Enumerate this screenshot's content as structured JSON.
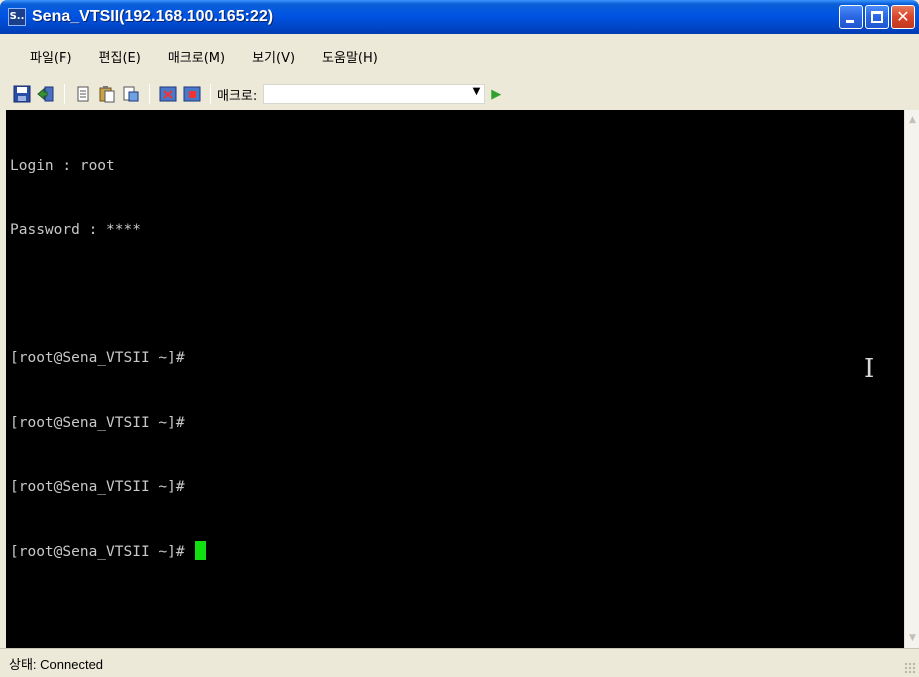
{
  "window": {
    "app_icon_text": "S..",
    "title": "Sena_VTSII(192.168.100.165:22)",
    "controls": {
      "minimize": "minimize",
      "maximize": "maximize",
      "close": "close"
    }
  },
  "menu": {
    "items": [
      {
        "label": "파일(F)"
      },
      {
        "label": "편집(E)"
      },
      {
        "label": "매크로(M)"
      },
      {
        "label": "보기(V)"
      },
      {
        "label": "도움말(H)"
      }
    ]
  },
  "toolbar": {
    "icons": [
      "save-icon",
      "connect-icon",
      "copy-icon",
      "paste-icon",
      "paste-special-icon",
      "macro-record-icon",
      "macro-stop-icon"
    ],
    "macro_label": "매크로:",
    "macro_value": "",
    "run_icon": "play-icon"
  },
  "terminal": {
    "lines": [
      "Login : root",
      "Password : ****",
      "",
      "[root@Sena_VTSII ~]#",
      "[root@Sena_VTSII ~]#",
      "[root@Sena_VTSII ~]#",
      "[root@Sena_VTSII ~]# "
    ],
    "colors": {
      "background": "#000000",
      "foreground": "#c8c8c8",
      "cursor": "#10e010"
    }
  },
  "statusbar": {
    "text": "상태: Connected"
  },
  "colors": {
    "titlebar": "#0054e3",
    "close_button": "#d8452a",
    "chrome": "#ece9d8"
  }
}
